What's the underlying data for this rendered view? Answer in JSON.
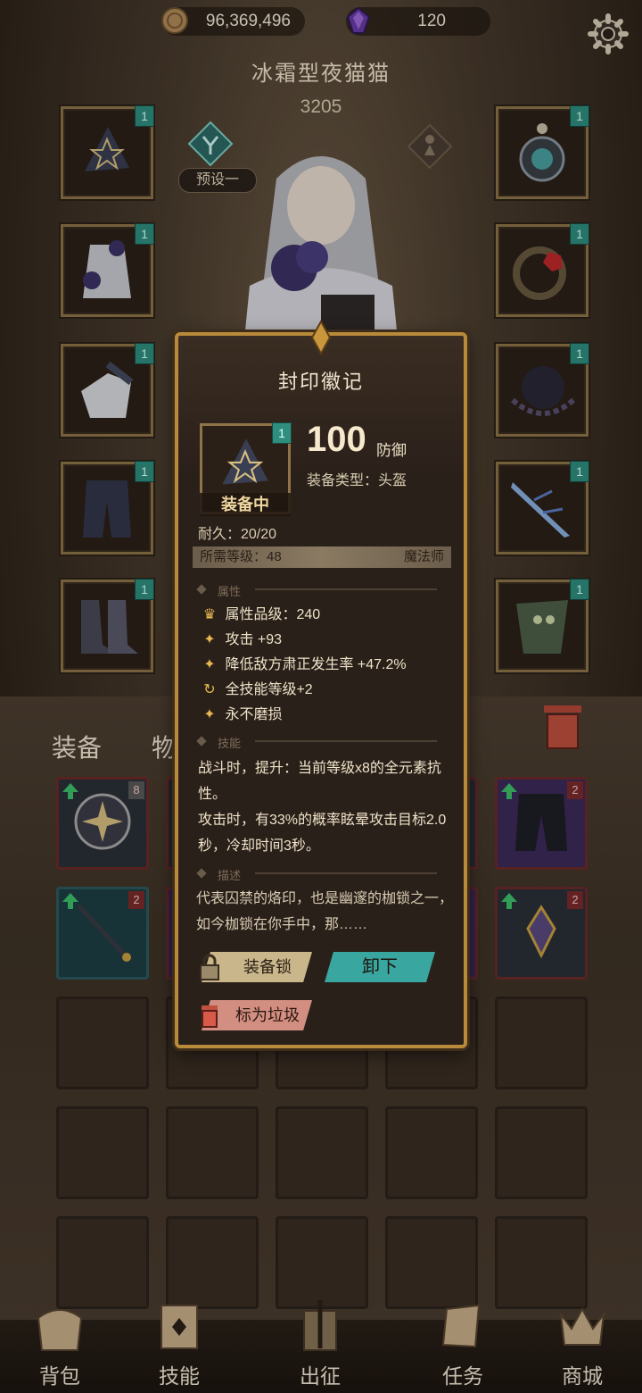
{
  "resources": {
    "gold": "96,369,496",
    "gems": "120"
  },
  "character": {
    "name": "冰霜型夜猫猫",
    "power": "3205",
    "preset": "预设一"
  },
  "slot_levels": [
    "1",
    "1",
    "1",
    "1",
    "1",
    "1",
    "1",
    "1",
    "1",
    "1"
  ],
  "tabs": {
    "equipment": "装备",
    "items": "物品"
  },
  "inventory": {
    "row1": [
      {
        "rank": "8",
        "up": true
      },
      {
        "rank": "",
        "up": true
      },
      {
        "rank": "",
        "up": true
      },
      {
        "rank": "",
        "up": false
      },
      {
        "rank": "2",
        "up": true
      }
    ],
    "row2": [
      {
        "rank": "2",
        "up": true
      },
      {
        "rank": "",
        "up": false
      },
      {
        "rank": "",
        "up": false
      },
      {
        "rank": "",
        "up": false
      },
      {
        "rank": "2",
        "up": true
      }
    ]
  },
  "nav": {
    "bag": "背包",
    "skills": "技能",
    "expedition": "出征",
    "tasks": "任务",
    "shop": "商城"
  },
  "popup": {
    "title": "封印徽记",
    "item_level": "1",
    "equipped": "装备中",
    "defense_value": "100",
    "defense_label": "防御",
    "equip_type": "装备类型：头盔",
    "durability": "耐久：20/20",
    "req_level": "所需等级：48",
    "req_class": "魔法师",
    "sec_attr": "属性",
    "attr_grade": "属性品级：240",
    "attack": "攻击 +93",
    "crit_reduce": "降低敌方肃正发生率 +47.2%",
    "all_skill": "全技能等级+2",
    "unbreakable": "永不磨损",
    "sec_skill": "技能",
    "skill_1": "战斗时，提升：当前等级x8的全元素抗性。",
    "skill_2": "攻击时，有33%的概率眩晕攻击目标2.0秒，冷却时间3秒。",
    "sec_desc": "描述",
    "description": "代表囚禁的烙印，也是幽邃的枷锁之一，如今枷锁在你手中，那……",
    "btn_lock": "装备锁",
    "btn_unequip": "卸下",
    "btn_junk": "标为垃圾"
  },
  "colors": {
    "accent_gold": "#b98a3a",
    "level_teal": "#2f8e7e",
    "upgrade_green": "#3cc06a"
  }
}
